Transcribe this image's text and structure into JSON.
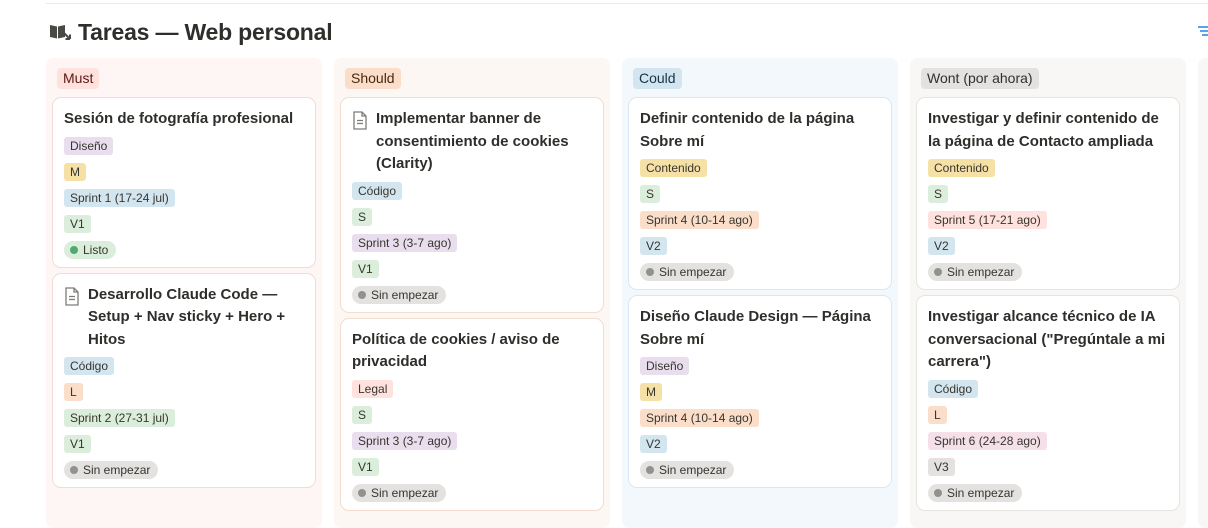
{
  "board": {
    "title": "Tareas — Web personal"
  },
  "colors": {
    "purple": "#e8deee",
    "yellow": "#f5e1a6",
    "blue": "#d3e5ef",
    "green": "#dbeddb",
    "orange": "#fadec9",
    "red": "#ffe2dd",
    "pink": "#f5e0e9",
    "gray": "#e3e2e0",
    "dot_green": "#4dab6f",
    "dot_gray": "#91918e"
  },
  "columns": [
    {
      "label": "Must",
      "bg": "#ffe2dd",
      "fg": "#5d1715",
      "cards": [
        {
          "title": "Sesión de fotografía profesional",
          "icon": false,
          "tags": [
            {
              "text": "Diseño",
              "c": "purple"
            },
            {
              "text": "M",
              "c": "yellow"
            },
            {
              "text": "Sprint 1 (17-24 jul)",
              "c": "blue"
            },
            {
              "text": "V1",
              "c": "green"
            }
          ],
          "status": {
            "text": "Listo",
            "c": "green",
            "dot": "dot_green"
          }
        },
        {
          "title": "Desarrollo Claude Code — Setup + Nav sticky + Hero + Hitos",
          "icon": true,
          "tags": [
            {
              "text": "Código",
              "c": "blue"
            },
            {
              "text": "L",
              "c": "orange"
            },
            {
              "text": "Sprint 2 (27-31 jul)",
              "c": "green"
            },
            {
              "text": "V1",
              "c": "green"
            }
          ],
          "status": {
            "text": "Sin empezar",
            "c": "gray",
            "dot": "dot_gray"
          }
        }
      ]
    },
    {
      "label": "Should",
      "bg": "#fadec9",
      "fg": "#49290e",
      "cards": [
        {
          "title": "Implementar banner de consentimiento de cookies (Clarity)",
          "icon": true,
          "tags": [
            {
              "text": "Código",
              "c": "blue"
            },
            {
              "text": "S",
              "c": "green"
            },
            {
              "text": "Sprint 3 (3-7 ago)",
              "c": "purple"
            },
            {
              "text": "V1",
              "c": "green"
            }
          ],
          "status": {
            "text": "Sin empezar",
            "c": "gray",
            "dot": "dot_gray"
          }
        },
        {
          "title": "Política de cookies / aviso de privacidad",
          "icon": false,
          "tags": [
            {
              "text": "Legal",
              "c": "red"
            },
            {
              "text": "S",
              "c": "green"
            },
            {
              "text": "Sprint 3 (3-7 ago)",
              "c": "purple"
            },
            {
              "text": "V1",
              "c": "green"
            }
          ],
          "status": {
            "text": "Sin empezar",
            "c": "gray",
            "dot": "dot_gray"
          }
        }
      ]
    },
    {
      "label": "Could",
      "bg": "#d3e5ef",
      "fg": "#183347",
      "cards": [
        {
          "title": "Definir contenido de la página Sobre mí",
          "icon": false,
          "tags": [
            {
              "text": "Contenido",
              "c": "yellow"
            },
            {
              "text": "S",
              "c": "green"
            },
            {
              "text": "Sprint 4 (10-14 ago)",
              "c": "orange"
            },
            {
              "text": "V2",
              "c": "blue"
            }
          ],
          "status": {
            "text": "Sin empezar",
            "c": "gray",
            "dot": "dot_gray"
          }
        },
        {
          "title": "Diseño Claude Design — Página Sobre mí",
          "icon": false,
          "tags": [
            {
              "text": "Diseño",
              "c": "purple"
            },
            {
              "text": "M",
              "c": "yellow"
            },
            {
              "text": "Sprint 4 (10-14 ago)",
              "c": "orange"
            },
            {
              "text": "V2",
              "c": "blue"
            }
          ],
          "status": {
            "text": "Sin empezar",
            "c": "gray",
            "dot": "dot_gray"
          }
        }
      ]
    },
    {
      "label": "Wont (por ahora)",
      "bg": "#e3e2e0",
      "fg": "#32302c",
      "cards": [
        {
          "title": "Investigar y definir contenido de la página de Contacto ampliada",
          "icon": false,
          "tags": [
            {
              "text": "Contenido",
              "c": "yellow"
            },
            {
              "text": "S",
              "c": "green"
            },
            {
              "text": "Sprint 5 (17-21 ago)",
              "c": "red"
            },
            {
              "text": "V2",
              "c": "blue"
            }
          ],
          "status": {
            "text": "Sin empezar",
            "c": "gray",
            "dot": "dot_gray"
          }
        },
        {
          "title": "Investigar alcance técnico de IA conversacional (\"Pregúntale a mi carrera\")",
          "icon": false,
          "tags": [
            {
              "text": "Código",
              "c": "blue"
            },
            {
              "text": "L",
              "c": "orange"
            },
            {
              "text": "Sprint 6 (24-28 ago)",
              "c": "pink"
            },
            {
              "text": "V3",
              "c": "gray"
            }
          ],
          "status": {
            "text": "Sin empezar",
            "c": "gray",
            "dot": "dot_gray"
          }
        }
      ]
    }
  ]
}
